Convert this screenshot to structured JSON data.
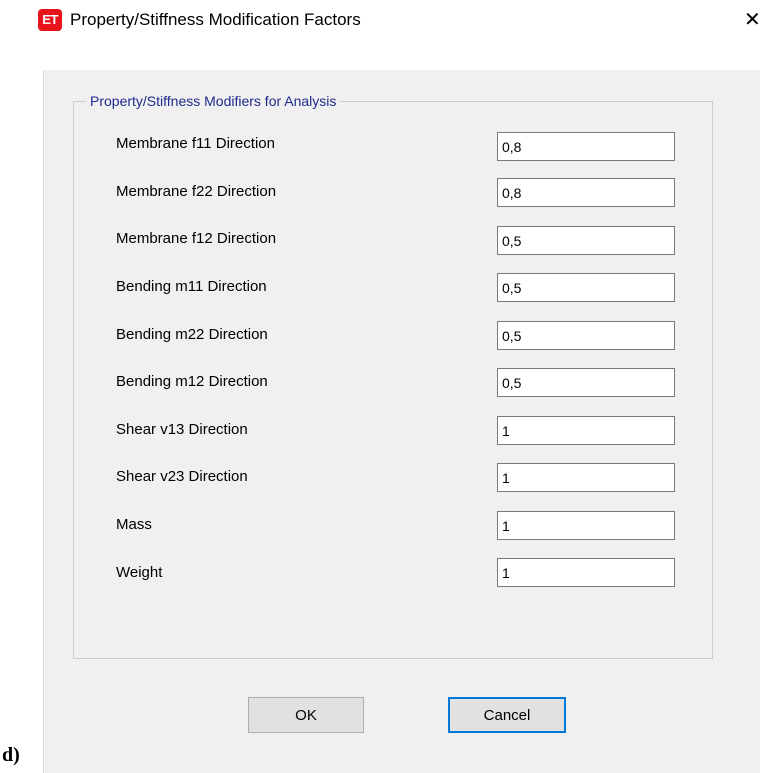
{
  "window": {
    "app_icon_text": "ET",
    "title": "Property/Stiffness Modification Factors",
    "close_glyph": "✕"
  },
  "group": {
    "title": "Property/Stiffness Modifiers for Analysis"
  },
  "rows": [
    {
      "label": "Membrane f11 Direction",
      "value": "0,8"
    },
    {
      "label": "Membrane f22 Direction",
      "value": "0,8"
    },
    {
      "label": "Membrane f12 Direction",
      "value": "0,5"
    },
    {
      "label": "Bending m11 Direction",
      "value": "0,5"
    },
    {
      "label": "Bending m22 Direction",
      "value": "0,5"
    },
    {
      "label": "Bending m12 Direction",
      "value": "0,5"
    },
    {
      "label": "Shear v13 Direction",
      "value": "1"
    },
    {
      "label": "Shear v23 Direction",
      "value": "1"
    },
    {
      "label": "Mass",
      "value": "1"
    },
    {
      "label": "Weight",
      "value": "1"
    }
  ],
  "buttons": {
    "ok_label": "OK",
    "cancel_label": "Cancel"
  },
  "caption": "d)",
  "colors": {
    "app_icon_bg": "#e8141b",
    "group_title": "#1f2a8c",
    "focus_border": "#0078d7"
  }
}
